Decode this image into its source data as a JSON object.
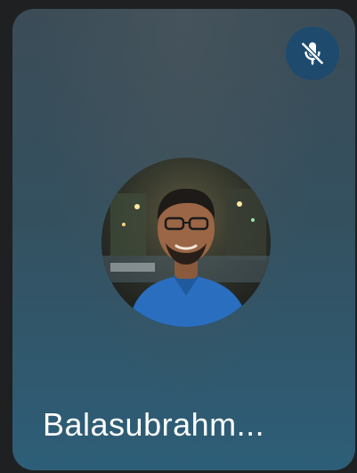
{
  "participant": {
    "name": "Balasubrahm...",
    "muted": true,
    "mute_icon": "microphone-off-icon",
    "avatar": "participant-avatar-photo"
  },
  "colors": {
    "tile_top": "#3b4c57",
    "tile_bottom": "#2d5e78",
    "mute_badge": "#1e4a6e",
    "name_text": "#ffffff"
  }
}
